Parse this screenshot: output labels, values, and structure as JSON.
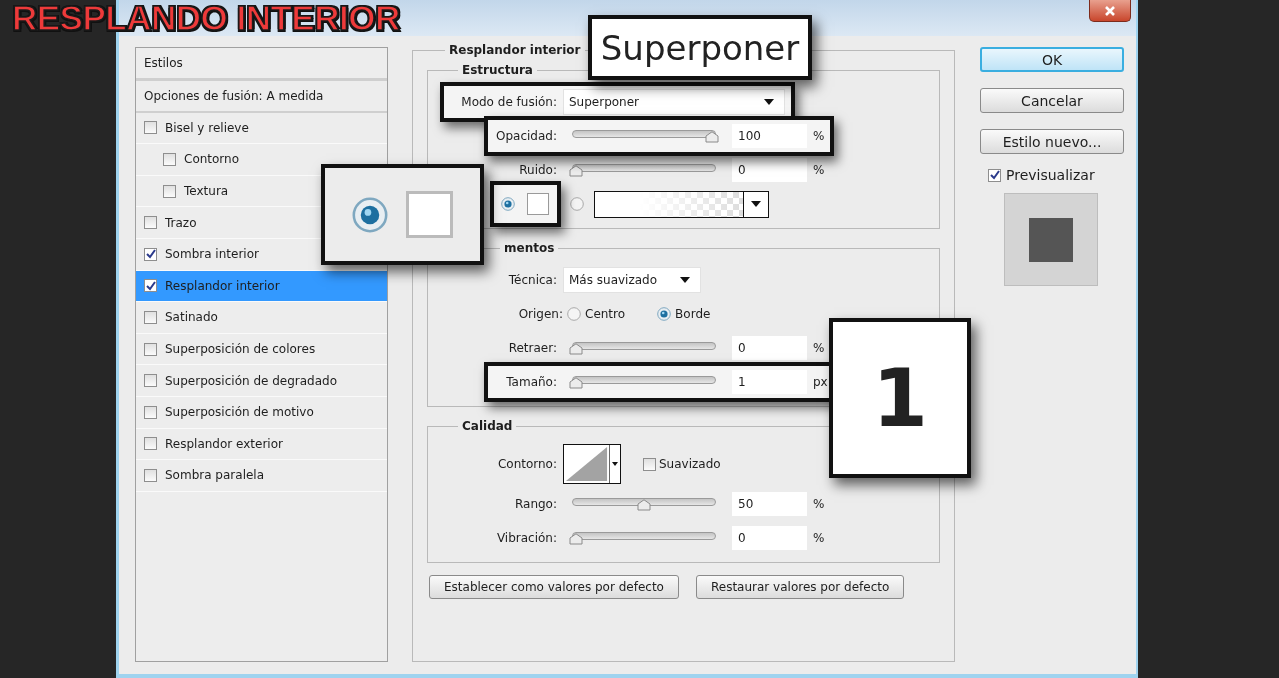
{
  "headline": "RESPLANDO INTERIOR",
  "styles_list": [
    {
      "kind": "header",
      "label": "Estilos",
      "selected": false
    },
    {
      "kind": "option",
      "label": "Opciones de fusión: A medida",
      "selected": false
    },
    {
      "kind": "effect",
      "label": "Bisel y relieve",
      "checked": false,
      "selected": false,
      "children": [
        {
          "kind": "effect",
          "label": "Contorno",
          "checked": false,
          "selected": false
        },
        {
          "kind": "effect",
          "label": "Textura",
          "checked": false,
          "selected": false
        }
      ]
    },
    {
      "kind": "effect",
      "label": "Trazo",
      "checked": false,
      "selected": false
    },
    {
      "kind": "effect",
      "label": "Sombra interior",
      "checked": true,
      "selected": false
    },
    {
      "kind": "effect",
      "label": "Resplandor interior",
      "checked": true,
      "selected": true
    },
    {
      "kind": "effect",
      "label": "Satinado",
      "checked": false,
      "selected": false
    },
    {
      "kind": "effect",
      "label": "Superposición de colores",
      "checked": false,
      "selected": false
    },
    {
      "kind": "effect",
      "label": "Superposición de degradado",
      "checked": false,
      "selected": false
    },
    {
      "kind": "effect",
      "label": "Superposición de motivo",
      "checked": false,
      "selected": false
    },
    {
      "kind": "effect",
      "label": "Resplandor exterior",
      "checked": false,
      "selected": false
    },
    {
      "kind": "effect",
      "label": "Sombra paralela",
      "checked": false,
      "selected": false
    }
  ],
  "panel": {
    "title": "Resplandor interior",
    "sections": [
      {
        "title": "Estructura",
        "rows": [
          {
            "kind": "select",
            "label": "Modo de fusión:",
            "value": "Superponer",
            "highlighted": true
          },
          {
            "kind": "slider",
            "label": "Opacidad:",
            "level": 1,
            "value": "100",
            "unit": "%",
            "highlighted": true
          },
          {
            "kind": "slider",
            "label": "Ruido:",
            "level": 0,
            "value": "0",
            "unit": "%",
            "highlighted": false
          },
          {
            "kind": "fill",
            "options": [
              {
                "kind": "color",
                "selected": true,
                "highlighted": true
              },
              {
                "kind": "gradient",
                "selected": false,
                "highlighted": false
              }
            ]
          }
        ]
      },
      {
        "title": "mentos",
        "rows": [
          {
            "kind": "select",
            "label": "Técnica:",
            "value": "Más suavizado",
            "highlighted": false
          },
          {
            "kind": "radio",
            "label": "Origen:",
            "options": [
              {
                "label": "Centro",
                "selected": false
              },
              {
                "label": "Borde",
                "selected": true
              }
            ]
          },
          {
            "kind": "slider",
            "label": "Retraer:",
            "level": 0,
            "value": "0",
            "unit": "%",
            "highlighted": false
          },
          {
            "kind": "slider",
            "label": "Tamaño:",
            "level": 0,
            "value": "1",
            "unit": "px",
            "highlighted": true
          }
        ]
      },
      {
        "title": "Calidad",
        "rows": [
          {
            "kind": "contour",
            "label": "Contorno:",
            "checkbox": {
              "label": "Suavizado",
              "checked": false
            }
          },
          {
            "kind": "slider",
            "label": "Rango:",
            "level": 0.5,
            "value": "50",
            "unit": "%",
            "highlighted": false
          },
          {
            "kind": "slider",
            "label": "Vibración:",
            "level": 0,
            "value": "0",
            "unit": "%",
            "highlighted": false
          }
        ]
      }
    ],
    "buttons": [
      "Establecer como valores por defecto",
      "Restaurar valores por defecto"
    ]
  },
  "actions": [
    {
      "label": "OK",
      "default": true
    },
    {
      "label": "Cancelar",
      "default": false
    },
    {
      "label": "Estilo nuevo...",
      "default": false
    }
  ],
  "preview": {
    "label": "Previsualizar",
    "checked": true
  },
  "callouts": [
    {
      "kind": "text",
      "text": "Superponer"
    },
    {
      "kind": "swatch",
      "selected": true
    },
    {
      "kind": "text",
      "text": "1"
    }
  ]
}
